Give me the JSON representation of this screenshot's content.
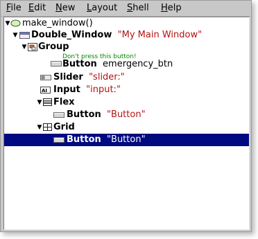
{
  "menubar": {
    "items": [
      {
        "mnemonic": "F",
        "rest": "ile"
      },
      {
        "mnemonic": "E",
        "rest": "dit"
      },
      {
        "mnemonic": "N",
        "rest": "ew"
      },
      {
        "mnemonic": "L",
        "rest": "ayout"
      },
      {
        "mnemonic": "S",
        "rest": "hell"
      },
      {
        "mnemonic": "H",
        "rest": "elp"
      }
    ]
  },
  "tree": {
    "nodes": [
      {
        "type": "make_window()",
        "label": "",
        "expanded": true,
        "icon": "function-icon"
      },
      {
        "type": "Double_Window",
        "label": "\"My Main Window\"",
        "expanded": true,
        "icon": "window-icon"
      },
      {
        "type": "Group",
        "label": "",
        "expanded": true,
        "icon": "group-icon"
      },
      {
        "type": "Button",
        "name": "emergency_btn",
        "tooltip": "Don't press this button!",
        "icon": "button-icon"
      },
      {
        "type": "Slider",
        "label": "\"slider:\"",
        "icon": "slider-icon"
      },
      {
        "type": "Input",
        "label": "\"input:\"",
        "icon": "input-icon"
      },
      {
        "type": "Flex",
        "label": "",
        "expanded": true,
        "icon": "flex-icon"
      },
      {
        "type": "Button",
        "label": "\"Button\"",
        "icon": "button-icon"
      },
      {
        "type": "Grid",
        "label": "",
        "expanded": true,
        "icon": "grid-icon"
      },
      {
        "type": "Button",
        "label": "\"Button\"",
        "selected": true,
        "icon": "button-icon"
      }
    ]
  },
  "colors": {
    "selection": "#000a80",
    "label_text": "#b31312",
    "tooltip_text": "#008800"
  }
}
